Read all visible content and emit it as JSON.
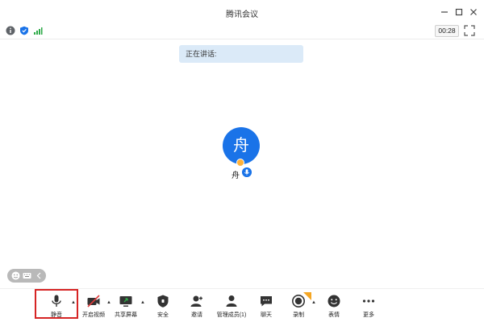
{
  "window": {
    "title": "腾讯会议"
  },
  "info_bar": {
    "timer": "00:28"
  },
  "speaking_banner": {
    "text": "正在讲话:"
  },
  "participant": {
    "avatar_char": "舟",
    "name": "舟"
  },
  "toolbar": {
    "items": [
      {
        "label": "静音",
        "icon": "microphone-icon"
      },
      {
        "label": "开启视频",
        "icon": "video-off-icon"
      },
      {
        "label": "共享屏幕",
        "icon": "share-screen-icon"
      },
      {
        "label": "安全",
        "icon": "shield-icon"
      },
      {
        "label": "邀请",
        "icon": "invite-icon"
      },
      {
        "label": "管理成员(1)",
        "icon": "members-icon"
      },
      {
        "label": "聊天",
        "icon": "chat-icon"
      },
      {
        "label": "录制",
        "icon": "record-icon"
      },
      {
        "label": "表情",
        "icon": "emoji-icon"
      },
      {
        "label": "更多",
        "icon": "more-icon"
      }
    ]
  },
  "colors": {
    "accent": "#1a73e8",
    "highlight": "#d62424",
    "banner": "#dbeaf8"
  }
}
